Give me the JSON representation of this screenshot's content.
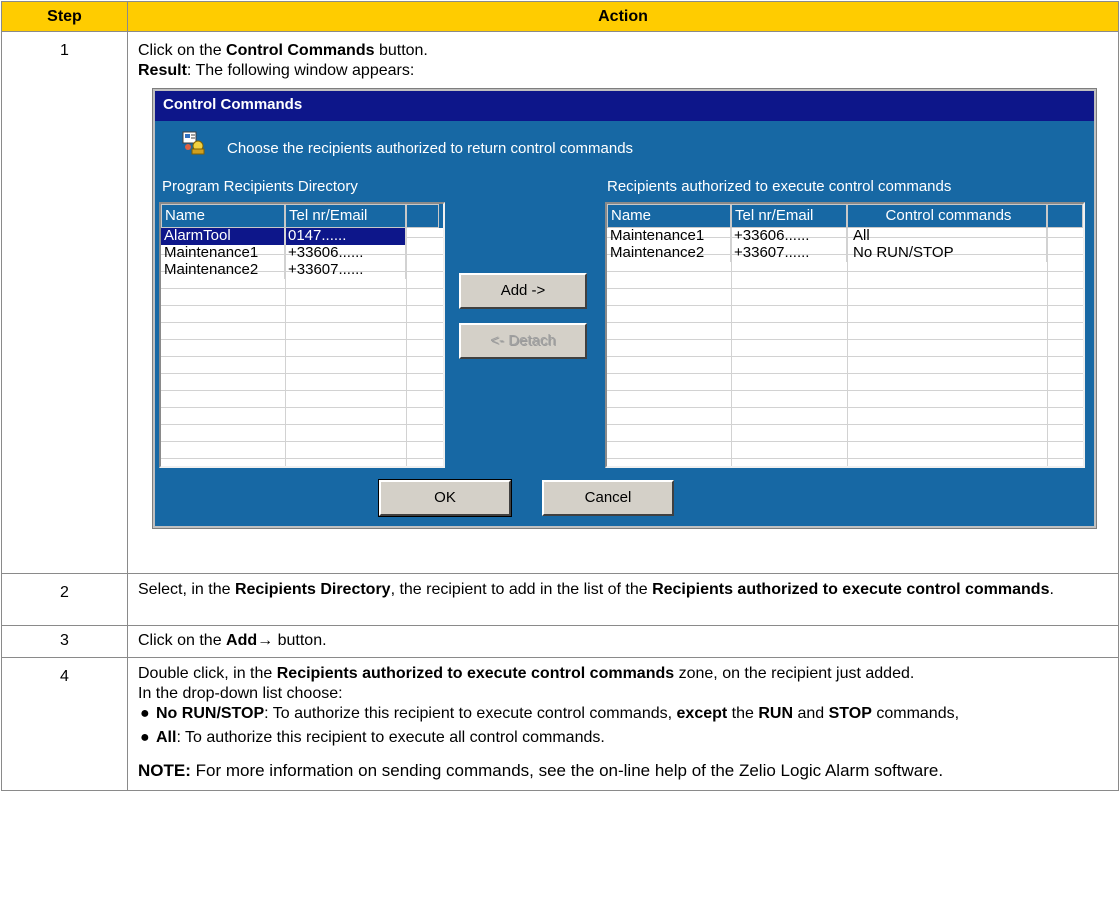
{
  "table": {
    "headers": [
      "Step",
      "Action"
    ],
    "rows": [
      {
        "step": "1",
        "line1_pre": "Click on the ",
        "line1_bold": "Control Commands",
        "line1_post": " button.",
        "line2_bold": "Result",
        "line2_post": ": The following window appears:"
      },
      {
        "step": "2",
        "pre": "Select, in the ",
        "bold1": "Recipients Directory",
        "mid": ", the recipient to add in the list of the ",
        "bold2": "Recipients authorized to execute control commands",
        "post": "."
      },
      {
        "step": "3",
        "pre": "Click on the ",
        "bold": "Add→",
        "post": " button."
      },
      {
        "step": "4",
        "pre": "Double click, in the ",
        "bold": "Recipients authorized to execute control commands",
        "post": " zone, on the recipient just added.",
        "line2": "In the drop-down list choose:",
        "bullet1_bold": "No RUN/STOP",
        "bullet1_pre": ": To authorize this recipient to execute control commands, ",
        "bullet1_bold2": "except",
        "bullet1_mid": " the ",
        "bullet1_bold3": "RUN",
        "bullet1_and": " and ",
        "bullet1_bold4": "STOP",
        "bullet1_post": " commands,",
        "bullet2_bold": "All",
        "bullet2_post": ": To authorize this recipient to execute all control commands.",
        "note_label": "NOTE:",
        "note_text": " For more information on sending commands, see the on-line help of the Zelio Logic Alarm software."
      }
    ]
  },
  "dialog": {
    "title": "Control Commands",
    "message": "Choose the recipients authorized to return control commands",
    "left_label": "Program Recipients Directory",
    "right_label": "Recipients authorized to execute control commands",
    "left_columns": [
      "Name",
      "Tel nr/Email"
    ],
    "left_rows": [
      [
        "AlarmTool",
        "0147......"
      ],
      [
        "Maintenance1",
        "+33606......"
      ],
      [
        "Maintenance2",
        "+33607......"
      ]
    ],
    "right_columns": [
      "Name",
      "Tel nr/Email",
      "Control commands"
    ],
    "right_rows": [
      [
        "Maintenance1",
        "+33606......",
        "All"
      ],
      [
        "Maintenance2",
        "+33607......",
        "No RUN/STOP"
      ]
    ],
    "add_label": "Add ->",
    "detach_label": "<- Detach",
    "ok_label": "OK",
    "cancel_label": "Cancel"
  }
}
